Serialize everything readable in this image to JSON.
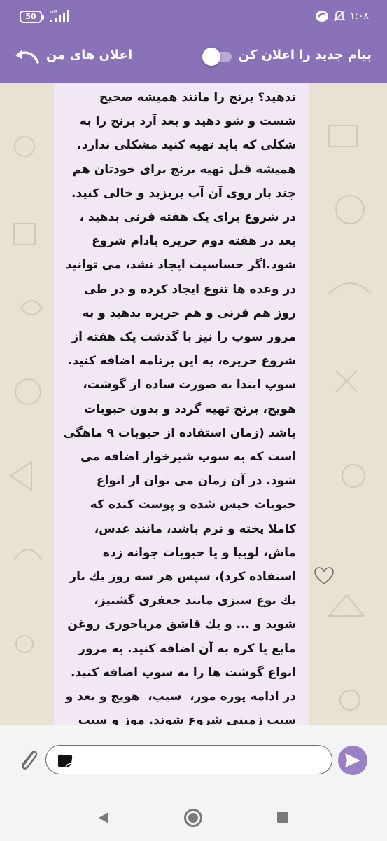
{
  "status_bar": {
    "battery": "50",
    "network": "4G",
    "time": "۱:۰۸"
  },
  "header": {
    "title": "اعلان های من",
    "toggle_label": "پیام جدید را اعلان کن",
    "toggle_on": false,
    "accent_color": "#8a72b8"
  },
  "message": {
    "text": "ندهید؟ برنج را مانند همیشه صحیح شست و شو دهید و بعد آرد برنج را به شکلی که باید تهیه کنید مشکلی ندارد. همیشه قبل تهیه برنج برای خودتان هم چند بار روی آن آب بریزید و خالی کنید.\nدر شروع برای یک هفته فرنی بدهید ، بعد در هفته دوم حریره بادام شروع شود.اگر حساسیت ایجاد نشد، می توانید در وعده ها تنوع ایجاد کرده و در طی روز هم فرنی و هم حریره بدهید و به مرور سوپ را نیز با گذشت یک هفته از شروع حریره، به این برنامه اضافه کنید. سوپ ابتدا به صورت ساده از گوشت، هویج، برنج تهیه گردد و بدون حبوبات باشد (زمان استفاده از حبوبات ۹ ماهگی است که به سوپ شیرخوار اضافه می شود. در آن زمان می توان از انواع حبوبات خیس شده و پوست کنده که کاملا پخته و نرم باشد، مانند عدس، ماش، لوبیا و یا حبوبات جوانه زده استفاده کرد)، سپس هر سه روز یك بار یك نوع سبزی مانند جعفری گشنیز، شوید و ... و یك قاشق مرباخوری روغن مایع یا کره به آن اضافه کنید. به مرور انواع گوشت ها را به سوپ اضافه کنید.\nدر ادامه پوره موز،  سیب،  هویج و بعد و سیب زمینی شروع شوند. موز و سیب می‌توانید به فرنی کم کم اضافه کنید. یادتان باشد برای شروع هر ماده غذایی جدید"
  },
  "input": {
    "placeholder": "",
    "value": ""
  },
  "icons": {
    "back": "back-arrow-icon",
    "attach": "paperclip-icon",
    "sticker": "sticker-icon",
    "send": "send-icon",
    "like": "heart-icon"
  }
}
